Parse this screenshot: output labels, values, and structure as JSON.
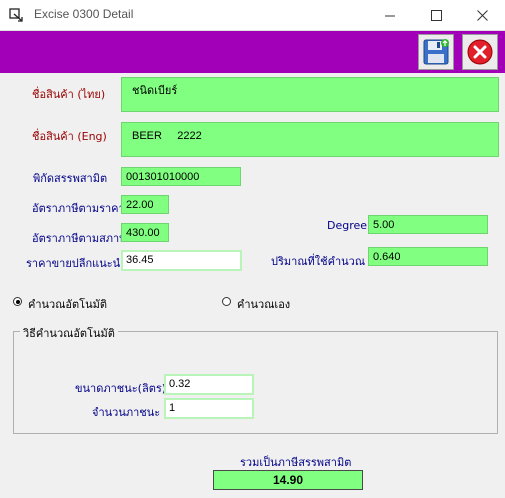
{
  "window": {
    "title": "Excise 0300 Detail",
    "icons": {
      "app": "app-icon",
      "minimize": "minimize-icon",
      "maximize": "maximize-icon",
      "close": "close-icon"
    }
  },
  "toolbar": {
    "color": "#a100b8",
    "save_icon": "floppy-save-icon",
    "cancel_icon": "red-x-icon"
  },
  "product": {
    "name_th_label": "ชื่อสินค้า (ไทย)",
    "name_th_value": "ชนิดเบียร์",
    "name_en_label": "ชื่อสินค้า (Eng)",
    "name_en_value": "BEER     2222"
  },
  "tax": {
    "code_label": "พิกัดสรรพสามิต",
    "code_value": "001301010000",
    "rate_price_label": "อัตราภาษีตามราคา",
    "rate_price_value": "22.00",
    "rate_volume_label": "อัตราภาษีตามสภาพ",
    "rate_volume_value": "430.00",
    "retail_label": "ราคาขายปลีกแนะนำ",
    "retail_value": "36.45",
    "degree_label": "Degree",
    "degree_value": "5.00",
    "qty_label": "ปริมาณที่ใช้คำนวณ",
    "qty_value": "0.640"
  },
  "mode": {
    "auto_label": "คำนวณอัตโนมัติ",
    "manual_label": "คำนวณเอง",
    "selected": "auto"
  },
  "auto_group": {
    "title": "วิธีคำนวณอัตโนมัติ",
    "container_size_label": "ขนาดภาชนะ(ลิตร)",
    "container_size_value": "0.32",
    "container_count_label": "จำนวนภาชนะ",
    "container_count_value": "1"
  },
  "total": {
    "label": "รวมเป็นภาษีสรรพสามิต",
    "value": "14.90"
  }
}
